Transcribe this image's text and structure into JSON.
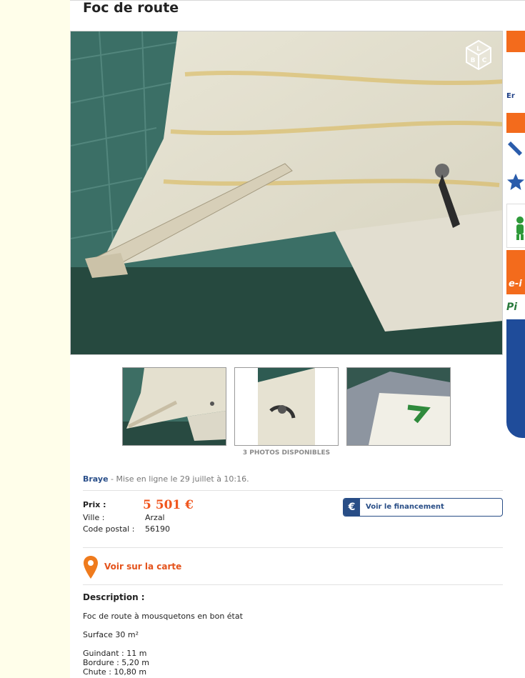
{
  "ad": {
    "title": "Foc de route",
    "photos_available": "3 PHOTOS DISPONIBLES",
    "seller": "Braye",
    "posted": "- Mise en ligne le 29 juillet à 10:16."
  },
  "watermark": {
    "letters": [
      "L",
      "B",
      "C"
    ]
  },
  "details": {
    "price_label": "Prix :",
    "price": "5 501 €",
    "city_label": "Ville :",
    "city": "Arzal",
    "postal_label": "Code postal :",
    "postal": "56190"
  },
  "financing": {
    "icon": "€",
    "label": "Voir le financement"
  },
  "map": {
    "link": "Voir sur la carte"
  },
  "description": {
    "title": "Description :",
    "lines": [
      "Foc de route à mousquetons en bon état",
      "Surface 30 m²",
      "Guindant : 11 m",
      "Bordure : 5,20 m",
      "Chute : 10,80 m"
    ]
  },
  "sidebar": {
    "cut_text_1": "Er",
    "cut_text_2": "Pi",
    "cut_text_3": "e-i"
  },
  "colors": {
    "accent": "#f0561e",
    "brand_blue": "#284d86",
    "gutter": "#fffeea"
  }
}
